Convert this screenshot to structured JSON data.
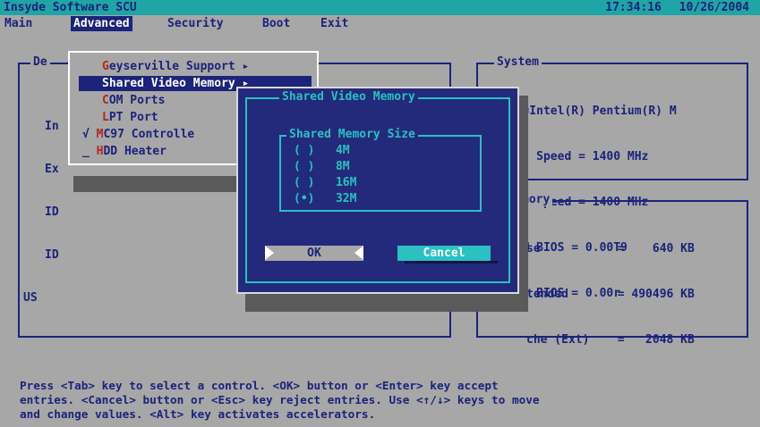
{
  "app": {
    "title": "Insyde Software SCU",
    "time": "17:34:16",
    "date": "10/26/2004"
  },
  "menu": [
    {
      "label": "Main"
    },
    {
      "label": "Advanced"
    },
    {
      "label": "Security"
    },
    {
      "label": "Boot"
    },
    {
      "label": "Exit"
    }
  ],
  "left_panel": {
    "title": "De",
    "rows": [
      "In",
      "Ex",
      "ID",
      "ID",
      "US"
    ]
  },
  "system_panel": {
    "title": "System",
    "rows": [
      "CPU=Intel(R) Pentium(R) M",
      "X    Speed = 1400 MHz",
      "U    Speed = 1400 MHz",
      "STEM BIOS = 0.00T9",
      "     BIOS = 0.00r"
    ]
  },
  "memory_panel": {
    "title": "mory",
    "rows": [
      "se           =    640 KB",
      "tended       = 490496 KB",
      "che (Ext)    =   2048 KB"
    ]
  },
  "dropdown": {
    "items": [
      {
        "mark": "",
        "hot": "G",
        "rest": "eyserville Support ▸",
        "selected": false
      },
      {
        "mark": "",
        "hot": "",
        "rest": "Shared Video Memory ▸",
        "selected": true
      },
      {
        "mark": "",
        "hot": "C",
        "rest": "OM Ports",
        "selected": false
      },
      {
        "mark": "",
        "hot": "L",
        "rest": "PT Port",
        "selected": false
      },
      {
        "mark": "√",
        "hot": "M",
        "rest": "C97 Controlle",
        "selected": false
      },
      {
        "mark": "_",
        "hot": "H",
        "rest": "DD Heater",
        "selected": false
      }
    ]
  },
  "dialog": {
    "title": "Shared Video Memory",
    "group_title": "Shared Memory Size",
    "options": [
      {
        "marker": "( )",
        "label": "4M"
      },
      {
        "marker": "( )",
        "label": "8M"
      },
      {
        "marker": "( )",
        "label": "16M"
      },
      {
        "marker": "(•)",
        "label": "32M"
      }
    ],
    "ok_label": "OK",
    "cancel_label": "Cancel"
  },
  "status": {
    "lines": [
      "Press <Tab> key to select a control. <OK> button or <Enter> key accept",
      "entries. <Cancel> button or <Esc> key reject entries. Use <↑/↓> keys to move",
      "and change values. <Alt> key activates accelerators."
    ]
  },
  "colors": {
    "background": "#a7a7a7",
    "dark_blue": "#1b237a",
    "cyan": "#29c1c1",
    "highlight_red": "#b3261e"
  }
}
